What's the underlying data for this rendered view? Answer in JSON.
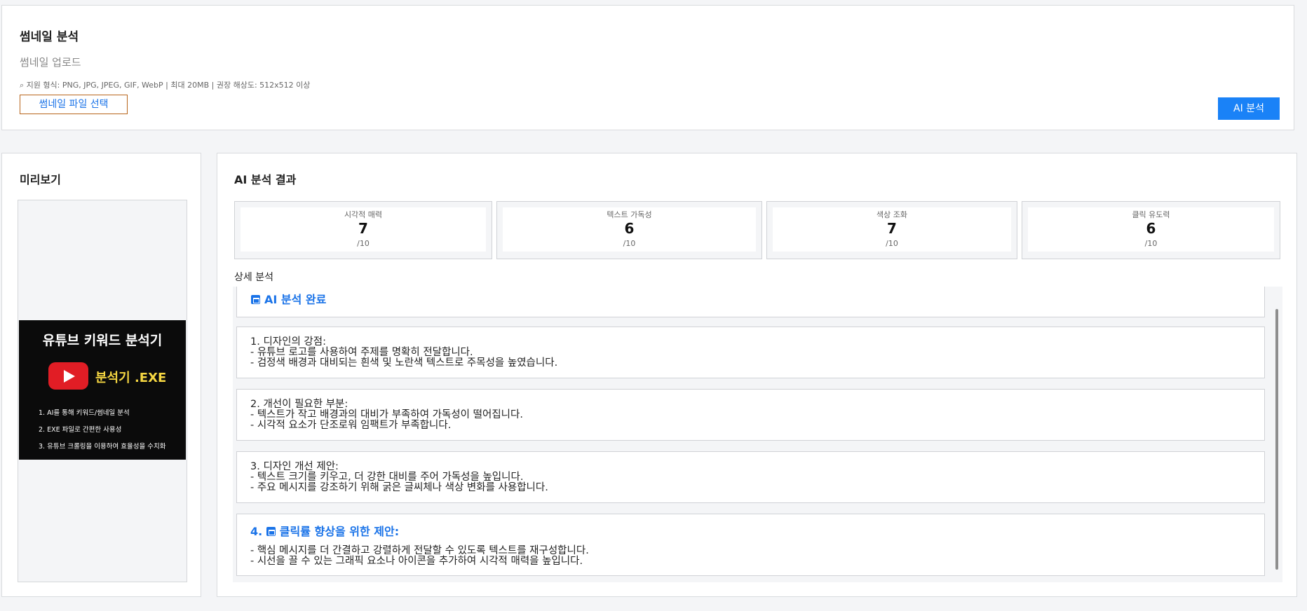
{
  "upload": {
    "title": "썸네일 분석",
    "upload_label": "썸네일 업로드",
    "note_icon": "magnifier-icon",
    "note": "지원 형식: PNG, JPG, JPEG, GIF, WebP | 최대 20MB | 권장 해상도: 512x512 이상",
    "file_button": "썸네일 파일 선택",
    "analyze_button": "AI 분석"
  },
  "preview": {
    "title": "미리보기",
    "thumbnail": {
      "headline": "유튜브 키워드 분석기",
      "exe_text": "분석기 .EXE",
      "items": [
        "1. AI를 통해 키워드/썸네일 분석",
        "2. EXE 파일로 간편한 사용성",
        "3. 유튜브 크롤링을 이용하여 효율성을 수치화"
      ]
    }
  },
  "results": {
    "title": "AI 분석 결과",
    "scores": [
      {
        "name": "시각적 매력",
        "value": "7",
        "max": "/10"
      },
      {
        "name": "텍스트 가독성",
        "value": "6",
        "max": "/10"
      },
      {
        "name": "색상 조화",
        "value": "7",
        "max": "/10"
      },
      {
        "name": "클릭 유도력",
        "value": "6",
        "max": "/10"
      }
    ],
    "detail_label": "상세 분석",
    "sections": {
      "done_title": "AI 분석 완료",
      "s1": {
        "title": "1. 디자인의 강점:",
        "lines": [
          "- 유튜브 로고를 사용하여 주제를 명확히 전달합니다.",
          "- 검정색 배경과 대비되는 흰색 및 노란색 텍스트로 주목성을 높였습니다."
        ]
      },
      "s2": {
        "title": "2. 개선이 필요한 부분:",
        "lines": [
          "- 텍스트가 작고 배경과의 대비가 부족하여 가독성이 떨어집니다.",
          "- 시각적 요소가 단조로워 임팩트가 부족합니다."
        ]
      },
      "s3": {
        "title": "3. 디자인 개선 제안:",
        "lines": [
          "- 텍스트 크기를 키우고, 더 강한 대비를 주어 가독성을 높입니다.",
          "- 주요 메시지를 강조하기 위해 굵은 글씨체나 색상 변화를 사용합니다."
        ]
      },
      "s4": {
        "number": "4.",
        "title": "클릭률 향상을 위한 제안:",
        "lines": [
          "- 핵심 메시지를 더 간결하고 강렬하게 전달할 수 있도록 텍스트를 재구성합니다.",
          "- 시선을 끌 수 있는 그래픽 요소나 아이콘을 추가하여 시각적 매력을 높입니다."
        ]
      }
    }
  }
}
